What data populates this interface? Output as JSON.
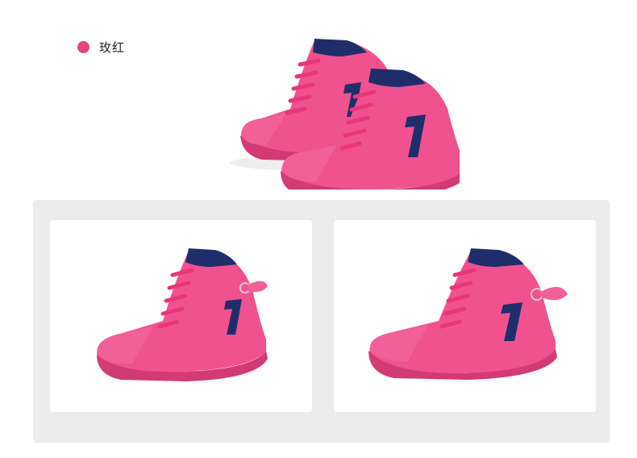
{
  "color_option": {
    "label": "玫红",
    "swatch_color": "#e5447f"
  },
  "colors": {
    "shoe_pink": "#f0528f",
    "shoe_dark_pink": "#d23a76",
    "sole_pink": "#f2609a",
    "navy": "#1f2e6b",
    "panel_bg": "#ececec"
  },
  "images": [
    {
      "name": "hero-pair",
      "icon": "sneaker-pair"
    },
    {
      "name": "side-view-left",
      "icon": "sneaker-side"
    },
    {
      "name": "side-view-right",
      "icon": "sneaker-side"
    }
  ]
}
